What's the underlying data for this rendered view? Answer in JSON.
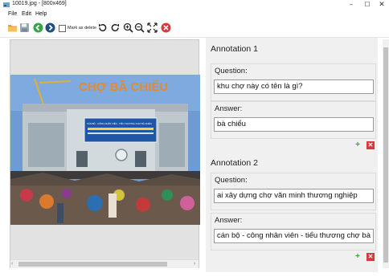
{
  "window": {
    "title": "10019.jpg - [800x469]",
    "minimize": "–",
    "maximize": "☐",
    "close": "✕"
  },
  "menu": {
    "items": [
      "File",
      "Edit",
      "Help"
    ]
  },
  "toolbar": {
    "mark_as_delete": "Mark as delete"
  },
  "image": {
    "sign_text": "CHỢ BÃ CHIỂU",
    "banner_text": "CÁN BỘ - CÔNG NHÂN VIÊN - TIỂU THƯƠNG CHỢ BÀ CHIỂU",
    "colors": {
      "sky": "#6f9bd4",
      "building": "#bfc8cd",
      "sign": "#e58b2c",
      "banner": "#1e57a8"
    }
  },
  "annotations": [
    {
      "title": "Annotation 1",
      "question_label": "Question:",
      "question": "khu chợ này có tên là gì?",
      "answer_label": "Answer:",
      "answer": "bà chiểu"
    },
    {
      "title": "Annotation 2",
      "question_label": "Question:",
      "question": "ai xây dựng chợ văn minh thương nghiệp",
      "answer_label": "Answer:",
      "answer": "cán bộ - công nhân viên - tiểu thương chợ bà chiểu"
    }
  ],
  "buttons": {
    "add": "+",
    "remove": "✕"
  },
  "colors": {
    "add": "#3aa53a",
    "remove": "#d9363e"
  }
}
